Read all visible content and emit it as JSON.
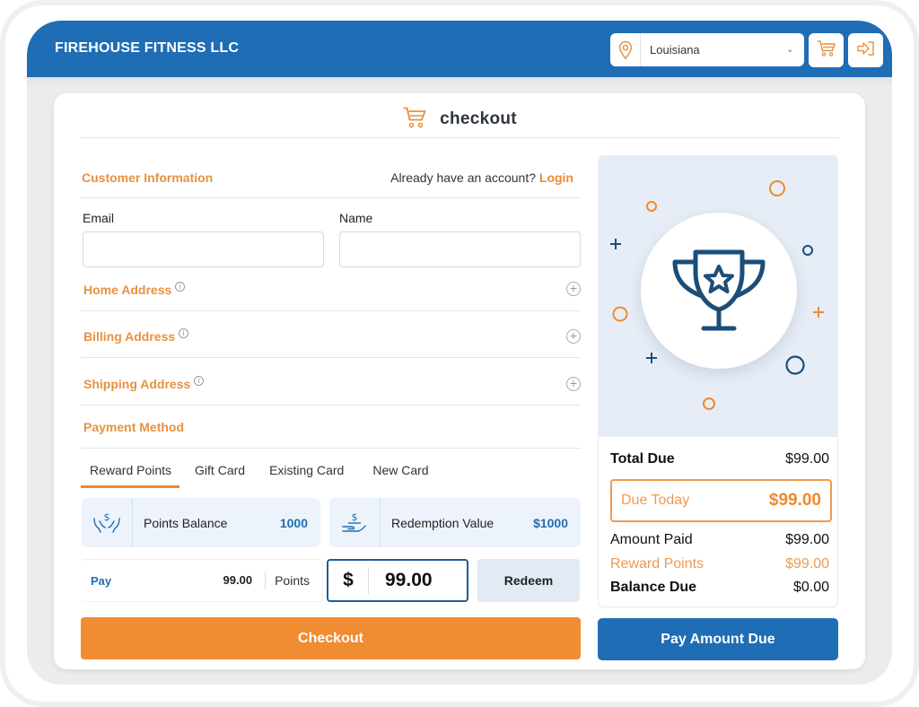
{
  "header": {
    "brand": "FIREHOUSE FITNESS LLC",
    "location_select": {
      "value": "Louisiana",
      "icon": "map-pin-icon"
    },
    "cart_icon": "cart-icon",
    "login_icon": "sign-in-icon"
  },
  "page": {
    "title": "checkout",
    "title_icon": "cart-icon"
  },
  "customer": {
    "heading": "Customer Information",
    "account_prompt": "Already have an account?",
    "login_link": "Login",
    "email_label": "Email",
    "email_value": "",
    "name_label": "Name",
    "name_value": ""
  },
  "sections": [
    {
      "label": "Home Address",
      "info_icon": "info-icon",
      "expand_icon": "plus-circle-icon"
    },
    {
      "label": "Billing Address",
      "info_icon": "info-icon",
      "expand_icon": "plus-circle-icon"
    },
    {
      "label": "Shipping Address",
      "info_icon": "info-icon",
      "expand_icon": "plus-circle-icon"
    }
  ],
  "payment": {
    "heading": "Payment Method",
    "tabs": [
      {
        "label": "Reward Points",
        "active": true
      },
      {
        "label": "Gift Card",
        "active": false
      },
      {
        "label": "Existing Card",
        "active": false
      },
      {
        "label": "New Card",
        "active": false
      }
    ],
    "points_balance": {
      "label": "Points Balance",
      "value": "1000",
      "icon": "hands-dollar-icon"
    },
    "redemption_value": {
      "label": "Redemption Value",
      "value": "$1000",
      "icon": "hand-dollar-icon"
    },
    "pay_row": {
      "label": "Pay",
      "amount": "99.00",
      "unit": "Points"
    },
    "dollar_input": {
      "currency": "$",
      "value": "99.00"
    },
    "redeem_label": "Redeem",
    "checkout_label": "Checkout"
  },
  "summary": {
    "hero_icon": "trophy-star-icon",
    "total_due": {
      "label": "Total Due",
      "value": "$99.00"
    },
    "due_today": {
      "label": "Due Today",
      "value": "$99.00"
    },
    "amount_paid": {
      "label": "Amount Paid",
      "value": "$99.00"
    },
    "reward_points": {
      "label": "Reward Points",
      "value": "$99.00"
    },
    "balance_due": {
      "label": "Balance Due",
      "value": "$0.00"
    },
    "pay_button_label": "Pay Amount Due"
  },
  "colors": {
    "brand_blue": "#1f6db5",
    "accent_orange": "#f08c32",
    "navy": "#1b4e78"
  }
}
